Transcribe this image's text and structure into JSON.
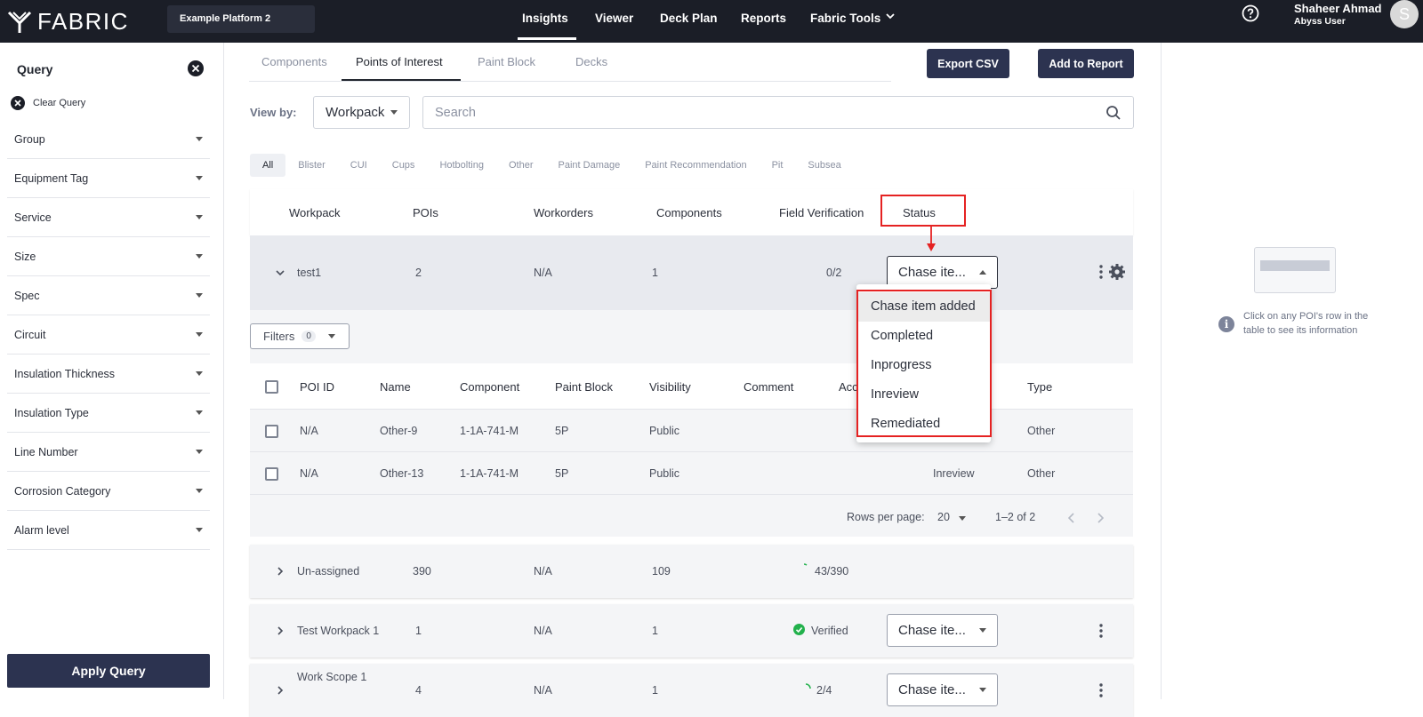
{
  "header": {
    "logo_text": "FABRIC",
    "platform_name": "Example Platform 2",
    "nav": [
      "Insights",
      "Viewer",
      "Deck Plan",
      "Reports",
      "Fabric Tools"
    ],
    "user_name": "Shaheer Ahmad",
    "user_role": "Abyss User",
    "avatar_letter": "S"
  },
  "sidebar": {
    "title": "Query",
    "clear_label": "Clear Query",
    "filters": [
      "Group",
      "Equipment Tag",
      "Service",
      "Size",
      "Spec",
      "Circuit",
      "Insulation Thickness",
      "Insulation Type",
      "Line Number",
      "Corrosion Category",
      "Alarm level"
    ],
    "apply_label": "Apply Query"
  },
  "main": {
    "tabs": [
      "Components",
      "Points of Interest",
      "Paint Block",
      "Decks"
    ],
    "active_tab": "Points of Interest",
    "export_label": "Export CSV",
    "add_report_label": "Add to Report",
    "viewby_label": "View by:",
    "viewby_value": "Workpack",
    "search_placeholder": "Search",
    "chips": [
      "All",
      "Blister",
      "CUI",
      "Cups",
      "Hotbolting",
      "Other",
      "Paint Damage",
      "Paint Recommendation",
      "Pit",
      "Subsea"
    ],
    "columns": [
      "Workpack",
      "POIs",
      "Workorders",
      "Components",
      "Field Verification",
      "Status"
    ],
    "rows": [
      {
        "name": "test1",
        "pois": "2",
        "workorders": "N/A",
        "components": "1",
        "verification": "0/2",
        "status": "Chase ite..."
      },
      {
        "name": "Un-assigned",
        "pois": "390",
        "workorders": "N/A",
        "components": "109",
        "verification": "43/390",
        "status": ""
      },
      {
        "name": "Test Workpack 1",
        "pois": "1",
        "workorders": "N/A",
        "components": "1",
        "verification": "Verified",
        "status": "Chase ite..."
      },
      {
        "name": "Work Scope 1",
        "pois": "4",
        "workorders": "N/A",
        "components": "1",
        "verification": "2/4",
        "status": "Chase ite..."
      }
    ],
    "filters_label": "Filters",
    "filters_count": "0",
    "inner_columns": [
      "POI ID",
      "Name",
      "Component",
      "Paint Block",
      "Visibility",
      "Comment",
      "Acc",
      "Type"
    ],
    "inner_rows": [
      {
        "poi_id": "N/A",
        "name": "Other-9",
        "component": "1-1A-741-M",
        "paint_block": "5P",
        "visibility": "Public",
        "status": "",
        "type": "Other"
      },
      {
        "poi_id": "N/A",
        "name": "Other-13",
        "component": "1-1A-741-M",
        "paint_block": "5P",
        "visibility": "Public",
        "status": "Inreview",
        "type": "Other"
      }
    ],
    "rows_per_page_label": "Rows per page:",
    "rows_per_page_value": "20",
    "page_range": "1–2 of 2",
    "status_options": [
      "Chase item added",
      "Completed",
      "Inprogress",
      "Inreview",
      "Remediated"
    ]
  },
  "right_panel": {
    "info_text": "Click on any POI's row in the table to see its information"
  },
  "colors": {
    "topbar": "#1b1e27",
    "primary_button": "#2c3350",
    "highlight_red": "#e52222",
    "verified_green": "#22b14c"
  }
}
